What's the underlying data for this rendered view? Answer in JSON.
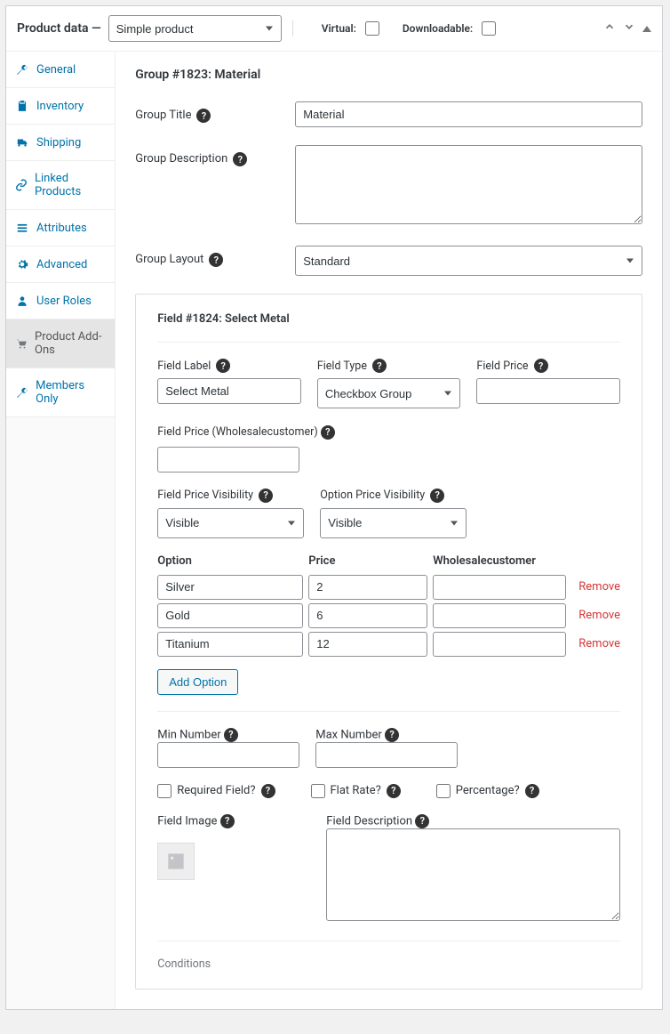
{
  "header": {
    "title": "Product data —",
    "product_type": "Simple product",
    "virtual_label": "Virtual:",
    "downloadable_label": "Downloadable:"
  },
  "tabs": [
    {
      "label": "General"
    },
    {
      "label": "Inventory"
    },
    {
      "label": "Shipping"
    },
    {
      "label": "Linked Products"
    },
    {
      "label": "Attributes"
    },
    {
      "label": "Advanced"
    },
    {
      "label": "User Roles"
    },
    {
      "label": "Product Add-Ons"
    },
    {
      "label": "Members Only"
    }
  ],
  "group": {
    "heading": "Group #1823: Material",
    "labels": {
      "title": "Group Title",
      "description": "Group Description",
      "layout": "Group Layout"
    },
    "values": {
      "title": "Material",
      "description": "",
      "layout": "Standard"
    }
  },
  "field": {
    "heading": "Field #1824: Select Metal",
    "labels": {
      "field_label": "Field Label",
      "field_type": "Field Type",
      "field_price": "Field Price",
      "field_price_wholesale": "Field Price (Wholesalecustomer)",
      "field_price_visibility": "Field Price Visibility",
      "option_price_visibility": "Option Price Visibility",
      "option": "Option",
      "price": "Price",
      "wholesale": "Wholesalecustomer",
      "remove": "Remove",
      "add_option": "Add Option",
      "min_number": "Min Number",
      "max_number": "Max Number",
      "required": "Required Field?",
      "flat_rate": "Flat Rate?",
      "percentage": "Percentage?",
      "field_image": "Field Image",
      "field_description": "Field Description",
      "conditions": "Conditions"
    },
    "values": {
      "field_label": "Select Metal",
      "field_type": "Checkbox Group",
      "field_price": "",
      "field_price_wholesale": "",
      "field_price_visibility": "Visible",
      "option_price_visibility": "Visible",
      "min_number": "",
      "max_number": "",
      "field_description": ""
    },
    "options": [
      {
        "name": "Silver",
        "price": "2",
        "wholesale": ""
      },
      {
        "name": "Gold",
        "price": "6",
        "wholesale": ""
      },
      {
        "name": "Titanium",
        "price": "12",
        "wholesale": ""
      }
    ]
  }
}
